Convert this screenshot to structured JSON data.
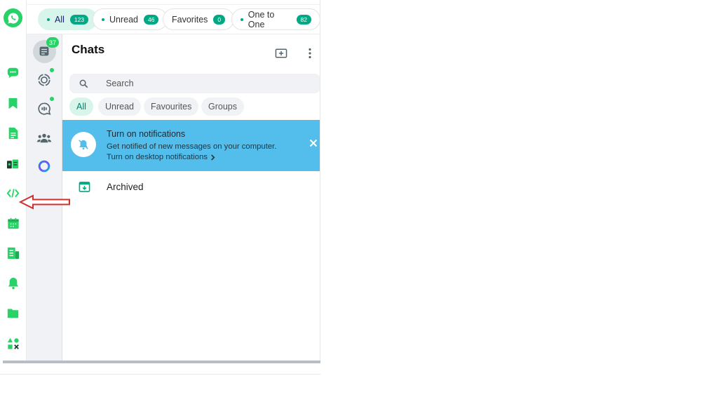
{
  "top_filters": [
    {
      "label": "All",
      "count": "123",
      "active": true
    },
    {
      "label": "Unread",
      "count": "46",
      "active": false
    },
    {
      "label": "Favorites",
      "count": "0",
      "active": false
    },
    {
      "label": "One to One",
      "count": "82",
      "active": false
    }
  ],
  "rail": {
    "icons": [
      "chat-bubble-icon",
      "bookmark-icon",
      "document-icon",
      "broadcast-icon",
      "code-icon",
      "calendar-icon",
      "report-icon",
      "bell-icon",
      "folder-icon",
      "shapes-icon"
    ]
  },
  "rail2": {
    "chats_badge": "37",
    "icons": [
      "chats-icon",
      "status-icon",
      "channels-icon",
      "communities-icon",
      "meta-ai-icon"
    ]
  },
  "panel": {
    "title": "Chats",
    "search_placeholder": "Search",
    "chips": [
      {
        "label": "All",
        "active": true
      },
      {
        "label": "Unread",
        "active": false
      },
      {
        "label": "Favourites",
        "active": false
      },
      {
        "label": "Groups",
        "active": false
      }
    ],
    "notification": {
      "title": "Turn on notifications",
      "description": "Get notified of new messages on your computer.",
      "link": "Turn on desktop notifications"
    },
    "archived_label": "Archived"
  },
  "colors": {
    "accent": "#25d366",
    "teal": "#00a884",
    "banner": "#53bdeb",
    "annotation_arrow": "#d32f2f"
  }
}
